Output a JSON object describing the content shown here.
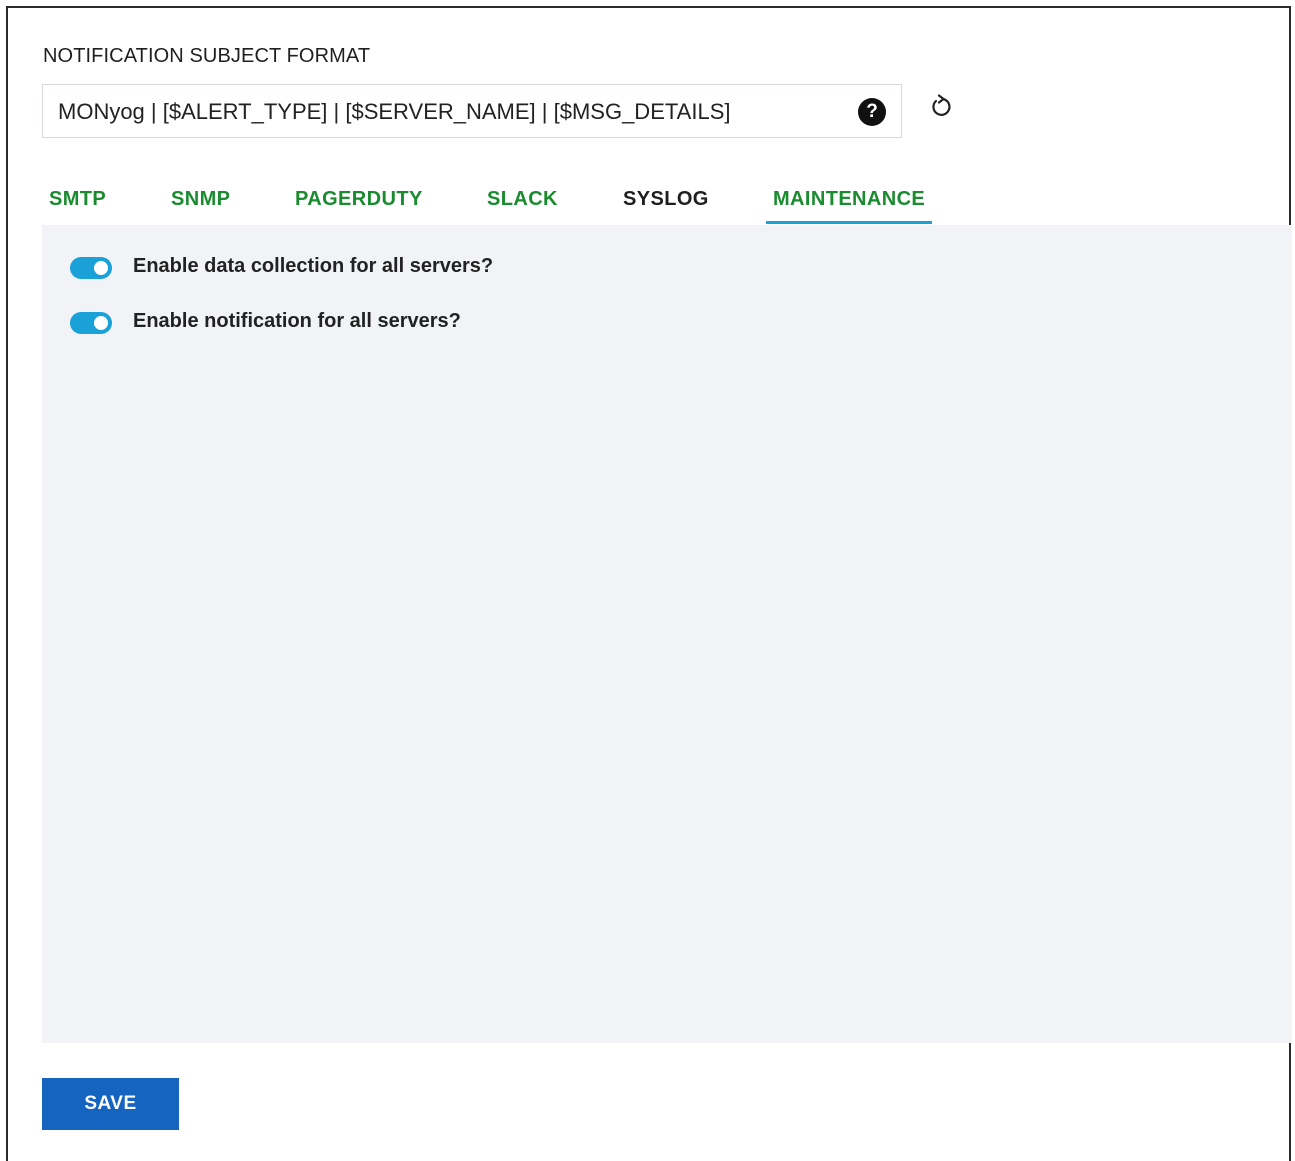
{
  "notification_subject": {
    "label": "NOTIFICATION SUBJECT FORMAT",
    "value": "MONyog | [$ALERT_TYPE] | [$SERVER_NAME] | [$MSG_DETAILS]",
    "help_icon": "question-circle-icon",
    "help_glyph": "?",
    "reset_icon": "reset-icon"
  },
  "tabs": [
    {
      "label": "SMTP",
      "active": false
    },
    {
      "label": "SNMP",
      "active": false
    },
    {
      "label": "PAGERDUTY",
      "active": false
    },
    {
      "label": "SLACK",
      "active": false
    },
    {
      "label": "SYSLOG",
      "active": false
    },
    {
      "label": "MAINTENANCE",
      "active": true
    }
  ],
  "maintenance": {
    "options": [
      {
        "label": "Enable data collection for all servers?",
        "enabled": true
      },
      {
        "label": "Enable notification for all servers?",
        "enabled": true
      }
    ]
  },
  "actions": {
    "save_label": "SAVE"
  },
  "colors": {
    "tab_green": "#1a8b2f",
    "accent_blue": "#1aa1d8",
    "save_blue": "#1565c0",
    "panel_bg": "#f1f3f6"
  }
}
